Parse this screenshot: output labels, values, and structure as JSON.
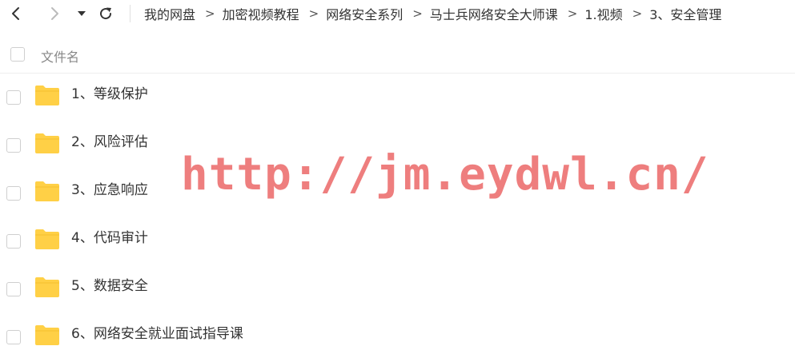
{
  "toolbar": {
    "back_icon": "chevron-left-icon",
    "forward_icon": "chevron-right-icon",
    "dropdown_icon": "caret-down-icon",
    "refresh_icon": "refresh-icon"
  },
  "breadcrumb": [
    {
      "label": "我的网盘"
    },
    {
      "label": "加密视频教程"
    },
    {
      "label": "网络安全系列"
    },
    {
      "label": "马士兵网络安全大师课"
    },
    {
      "label": "1.视频"
    },
    {
      "label": "3、安全管理"
    }
  ],
  "breadcrumb_separator": ">",
  "list": {
    "header": "文件名",
    "items": [
      {
        "name": "1、等级保护",
        "type": "folder"
      },
      {
        "name": "2、风险评估",
        "type": "folder"
      },
      {
        "name": "3、应急响应",
        "type": "folder"
      },
      {
        "name": "4、代码审计",
        "type": "folder"
      },
      {
        "name": "5、数据安全",
        "type": "folder"
      },
      {
        "name": "6、网络安全就业面试指导课",
        "type": "folder"
      }
    ]
  },
  "watermark": "http://jm.eydwl.cn/",
  "colors": {
    "folder": "#FFD046",
    "watermark": "#E95A5A",
    "text": "#333333",
    "header_text": "#888888"
  }
}
